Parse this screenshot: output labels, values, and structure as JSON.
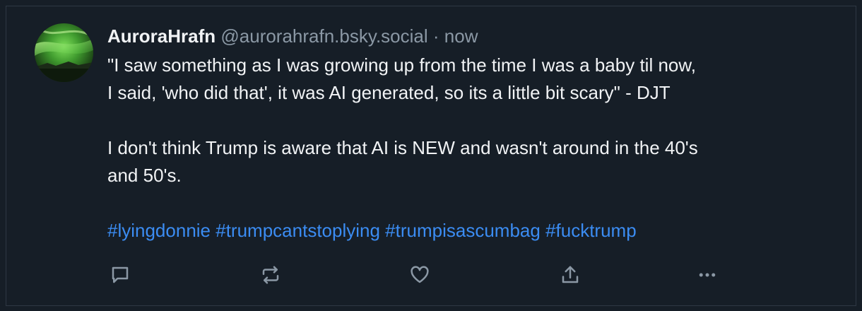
{
  "post": {
    "author": {
      "display_name": "AuroraHrafn",
      "handle": "@aurorahrafn.bsky.social",
      "separator": "·",
      "timestamp": "now"
    },
    "text_lines": [
      "\"I saw something as I was growing up from the time I was a baby til now,",
      "I said, 'who did that', it was AI generated, so its a little bit scary\" - DJT",
      "I don't think Trump is aware that AI is NEW and wasn't around in the 40's",
      "and 50's."
    ],
    "hashtags": [
      "#lyingdonnie",
      "#trumpcantstoplying",
      "#trumpisascumbag",
      "#fucktrump"
    ],
    "actions": {
      "reply_icon": "speech-bubble-icon",
      "repost_icon": "repost-arrows-icon",
      "like_icon": "heart-icon",
      "share_icon": "share-upload-icon",
      "more_icon": "ellipsis-icon"
    },
    "colors": {
      "background": "#161e27",
      "text": "#f1f3f5",
      "secondary_text": "#8b98a5",
      "link": "#3b8cf2",
      "icon": "#8b98a5"
    }
  }
}
